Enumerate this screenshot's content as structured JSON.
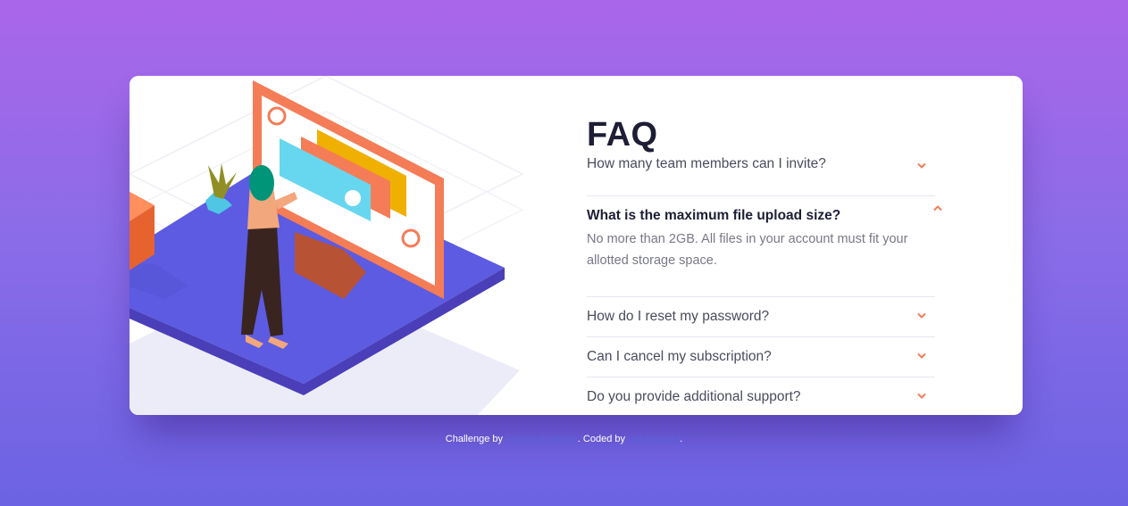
{
  "faq": {
    "title": "FAQ",
    "items": [
      {
        "question": "How many team members can I invite?",
        "open": false
      },
      {
        "question": "What is the maximum file upload size?",
        "open": true,
        "answer": "No more than 2GB. All files in your account must fit your allotted storage space."
      },
      {
        "question": "How do I reset my password?",
        "open": false
      },
      {
        "question": "Can I cancel my subscription?",
        "open": false
      },
      {
        "question": "Do you provide additional support?",
        "open": false
      }
    ]
  },
  "footer": {
    "prefix": "Challenge by ",
    "link1": "Frontend Mentor",
    "middle": ". Coded by ",
    "link2": "Gift Richard",
    "suffix": "."
  },
  "colors": {
    "accent": "#f47c57",
    "title": "#1d1e35",
    "bg_top": "#aa66ea",
    "bg_bottom": "#6b63e3"
  },
  "icons": {
    "chevron_closed": "chevron-down-icon",
    "chevron_open": "chevron-up-icon",
    "box_symbol": "@"
  }
}
